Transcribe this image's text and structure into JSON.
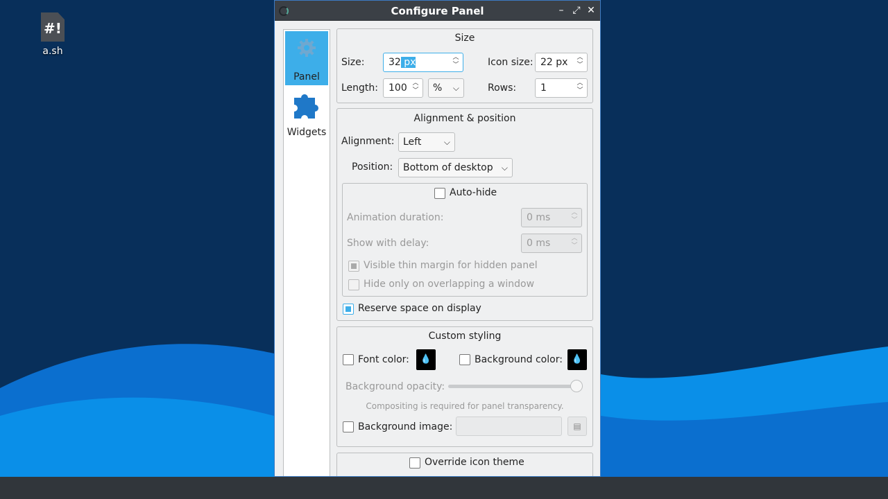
{
  "desktop": {
    "icon": {
      "name": "a.sh",
      "glyph": "#!"
    }
  },
  "window": {
    "title": "Configure Panel",
    "buttons": {
      "minimize": "–",
      "restore": "⤢",
      "close": "✕"
    }
  },
  "sidebar": {
    "items": [
      {
        "label": "Panel",
        "icon": "gear-icon"
      },
      {
        "label": "Widgets",
        "icon": "puzzle-icon"
      }
    ]
  },
  "size_group": {
    "title": "Size",
    "size_label": "Size:",
    "size_value_num": "32",
    "size_value_unit": " px",
    "icon_size_label": "Icon size:",
    "icon_size_value": "22 px",
    "length_label": "Length:",
    "length_value": "100",
    "length_unit": "%",
    "rows_label": "Rows:",
    "rows_value": "1"
  },
  "alignment_group": {
    "title": "Alignment & position",
    "alignment_label": "Alignment:",
    "alignment_value": "Left",
    "position_label": "Position:",
    "position_value": "Bottom of desktop",
    "autohide_label": "Auto-hide",
    "animation_label": "Animation duration:",
    "animation_value": "0 ms",
    "delay_label": "Show with delay:",
    "delay_value": "0 ms",
    "thin_margin_label": "Visible thin margin for hidden panel",
    "overlap_label": "Hide only on overlapping a window",
    "reserve_label": "Reserve space on display"
  },
  "styling_group": {
    "title": "Custom styling",
    "font_color_label": "Font color:",
    "bg_color_label": "Background color:",
    "opacity_label": "Background opacity:",
    "opacity_level": 1.0,
    "compositing_note": "Compositing is required for panel transparency.",
    "bg_image_label": "Background image:"
  },
  "icon_theme_group": {
    "override_label": "Override icon theme"
  },
  "colors": {
    "accent": "#3daee9",
    "titlebar": "#3b4046",
    "desktop_dark": "#082f5a",
    "wave": "#0a8fe8"
  }
}
